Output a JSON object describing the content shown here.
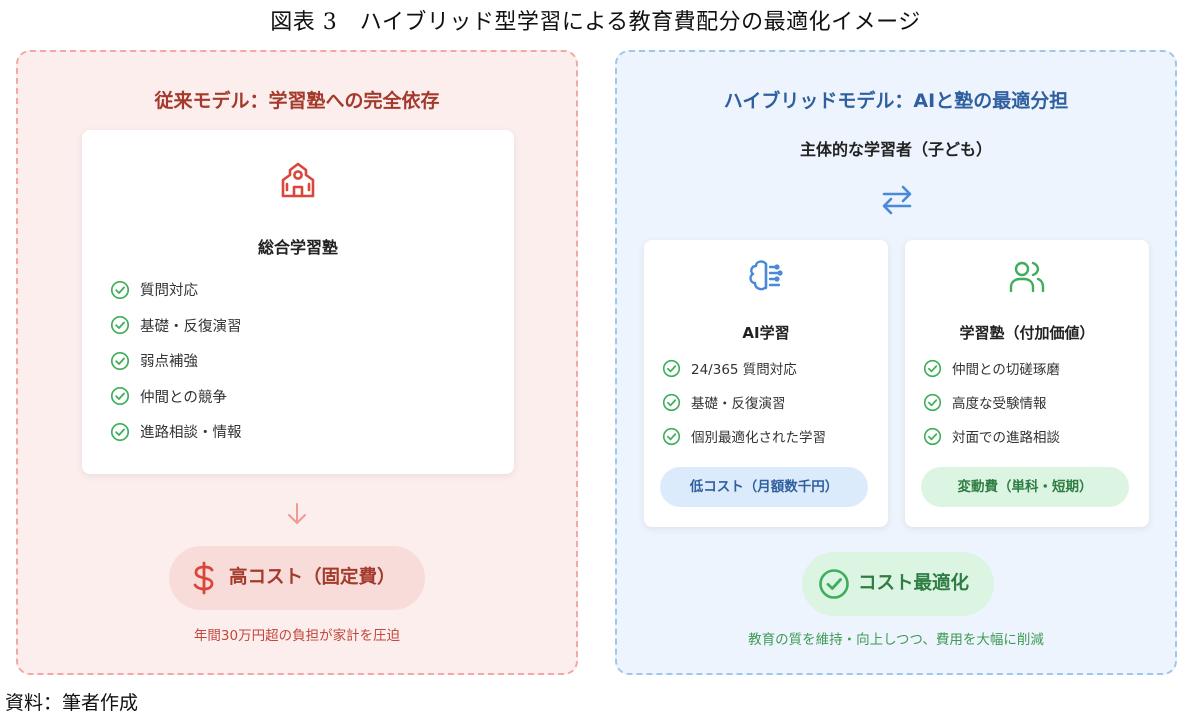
{
  "figure_title": "図表 3　ハイブリッド型学習による教育費配分の最適化イメージ",
  "left_panel": {
    "title": "従来モデル：学習塾への完全依存",
    "card": {
      "icon": "school-building-icon",
      "title": "総合学習塾",
      "items": [
        "質問対応",
        "基礎・反復演習",
        "弱点補強",
        "仲間との競争",
        "進路相談・情報"
      ]
    },
    "arrow_icon": "arrow-down-icon",
    "cost_icon": "dollar-icon",
    "cost_label": "高コスト（固定費）",
    "cost_caption": "年間30万円超の負担が家計を圧迫"
  },
  "right_panel": {
    "title": "ハイブリッドモデル：AIと塾の最適分担",
    "subtitle": "主体的な学習者（子ども）",
    "exchange_icon": "arrows-left-right-icon",
    "ai_card": {
      "icon": "brain-icon",
      "title": "AI学習",
      "items": [
        "24/365 質問対応",
        "基礎・反復演習",
        "個別最適化された学習"
      ],
      "pill": "低コスト（月額数千円）"
    },
    "juku_card": {
      "icon": "users-icon",
      "title": "学習塾（付加価値）",
      "items": [
        "仲間との切磋琢磨",
        "高度な受験情報",
        "対面での進路相談"
      ],
      "pill": "変動費（単科・短期）"
    },
    "result_icon": "check-circle-icon",
    "result_label": "コスト最適化",
    "result_caption": "教育の質を維持・向上しつつ、費用を大幅に削減"
  },
  "source": "資料：筆者作成",
  "colors": {
    "left_accent": "#d9473a",
    "right_accent": "#4a89d8",
    "check_green": "#3fae5a",
    "left_bg": "#fdeeee",
    "right_bg": "#edf4fd"
  }
}
